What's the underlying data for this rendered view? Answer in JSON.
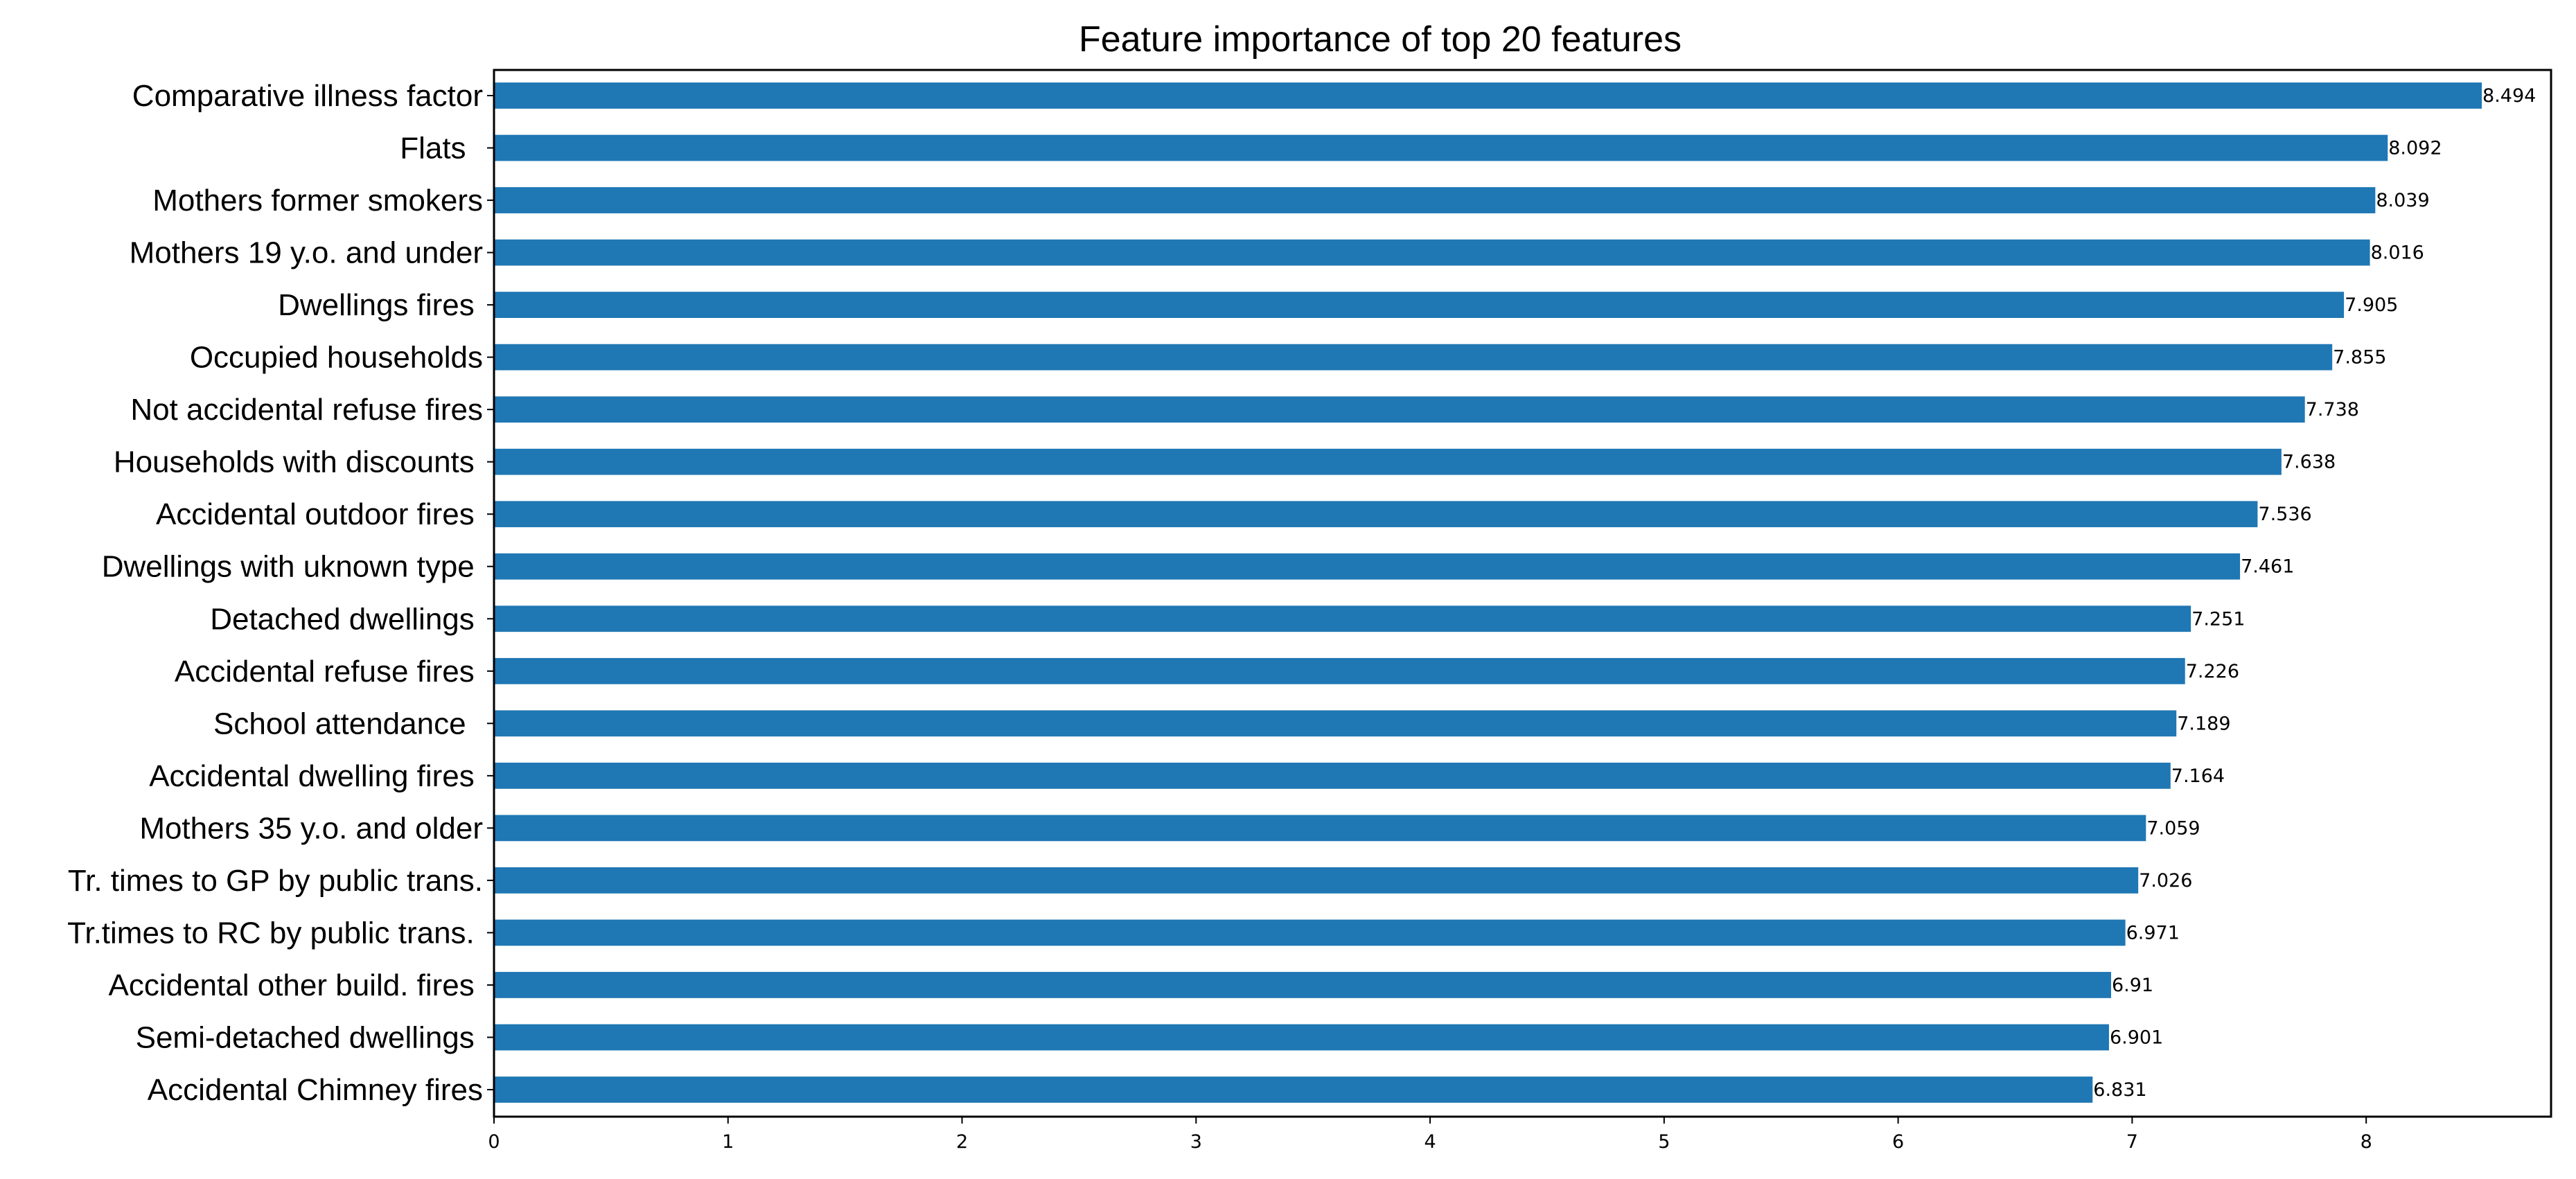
{
  "chart_data": {
    "type": "bar",
    "orientation": "horizontal",
    "title": "Feature importance of top 20 features",
    "xlabel": "",
    "ylabel": "",
    "xlim": [
      0,
      8.79
    ],
    "xticks": [
      0,
      1,
      2,
      3,
      4,
      5,
      6,
      7,
      8
    ],
    "grid": false,
    "legend": null,
    "bar_color": "#1f77b4",
    "categories": [
      "Comparative illness factor",
      "Flats  ",
      "Mothers former smokers",
      "Mothers 19 y.o. and under",
      "Dwellings fires ",
      "Occupied households",
      "Not accidental refuse fires",
      "Households with discounts ",
      "Accidental outdoor fires ",
      "Dwellings with uknown type ",
      "Detached dwellings ",
      "Accidental refuse fires ",
      "School attendance  ",
      "Accidental dwelling fires ",
      "Mothers 35 y.o. and older",
      "Tr. times to GP by public trans.",
      "Tr.times to RC by public trans. ",
      "Accidental other build. fires ",
      "Semi-detached dwellings ",
      "Accidental Chimney fires"
    ],
    "values": [
      8.494,
      8.092,
      8.039,
      8.016,
      7.905,
      7.855,
      7.738,
      7.638,
      7.536,
      7.461,
      7.251,
      7.226,
      7.189,
      7.164,
      7.059,
      7.026,
      6.971,
      6.91,
      6.901,
      6.831
    ],
    "value_labels": [
      "8.494",
      "8.092",
      "8.039",
      "8.016",
      "7.905",
      "7.855",
      "7.738",
      "7.638",
      "7.536",
      "7.461",
      "7.251",
      "7.226",
      "7.189",
      "7.164",
      "7.059",
      "7.026",
      "6.971",
      "6.91",
      "6.901",
      "6.831"
    ]
  }
}
